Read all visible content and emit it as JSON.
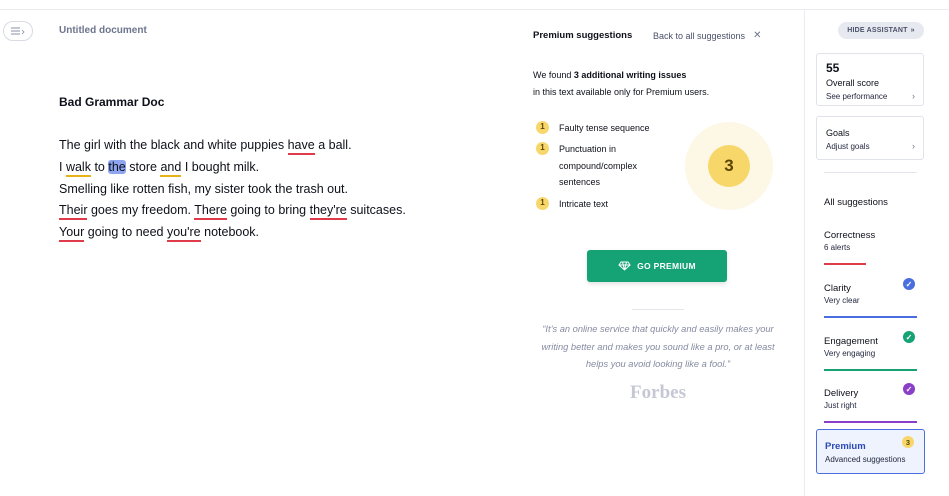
{
  "editor": {
    "doc_title": "Untitled document",
    "heading": "Bad Grammar Doc",
    "lines": [
      {
        "segments": [
          {
            "text": "The girl with the black and white puppies ",
            "mark": "none"
          },
          {
            "text": "have",
            "mark": "red"
          },
          {
            "text": " a ball.",
            "mark": "none"
          }
        ]
      },
      {
        "segments": [
          {
            "text": "I ",
            "mark": "none"
          },
          {
            "text": "walk",
            "mark": "yellow"
          },
          {
            "text": " to ",
            "mark": "none"
          },
          {
            "text": "the",
            "mark": "cursor"
          },
          {
            "text": " store ",
            "mark": "none"
          },
          {
            "text": "and",
            "mark": "yellow"
          },
          {
            "text": " I bought milk.",
            "mark": "none"
          }
        ]
      },
      {
        "segments": [
          {
            "text": "Smelling like rotten fish, my sister took the trash out.",
            "mark": "none"
          }
        ]
      },
      {
        "segments": [
          {
            "text": "Their",
            "mark": "red"
          },
          {
            "text": " goes my freedom. ",
            "mark": "none"
          },
          {
            "text": "There",
            "mark": "red"
          },
          {
            "text": " going to bring ",
            "mark": "none"
          },
          {
            "text": "they're",
            "mark": "red"
          },
          {
            "text": " suitcases.",
            "mark": "none"
          }
        ]
      },
      {
        "segments": [
          {
            "text": "Your",
            "mark": "red"
          },
          {
            "text": " going to need ",
            "mark": "none"
          },
          {
            "text": "you're",
            "mark": "red"
          },
          {
            "text": " notebook.",
            "mark": "none"
          }
        ]
      }
    ]
  },
  "premium_panel": {
    "title": "Premium suggestions",
    "back_link": "Back to all suggestions",
    "found_prefix": "We found ",
    "found_bold": "3 additional writing issues",
    "found_suffix": "in this text available only for Premium users.",
    "issues": [
      {
        "count": "1",
        "label": "Faulty tense sequence"
      },
      {
        "count": "1",
        "label": "Punctuation in compound/complex sentences"
      },
      {
        "count": "1",
        "label": "Intricate text"
      }
    ],
    "score_circle": "3",
    "cta_label": "GO PREMIUM",
    "quote": "“It’s an online service that quickly and easily makes your writing better and makes you sound like a pro, or at least helps you avoid looking like a fool.”",
    "quote_source": "Forbes"
  },
  "sidebar": {
    "hide_assistant": "HIDE ASSISTANT",
    "overall_score": {
      "value": "55",
      "label": "Overall score",
      "link": "See performance"
    },
    "goals": {
      "label": "Goals",
      "link": "Adjust goals"
    },
    "all_suggestions": "All suggestions",
    "categories": [
      {
        "name": "Correctness",
        "sub": "6 alerts",
        "color": "#e03b4b",
        "checked": false,
        "bar_fraction": 0.45
      },
      {
        "name": "Clarity",
        "sub": "Very clear",
        "color": "#4a6ee0",
        "checked": true,
        "bar_fraction": 1.0
      },
      {
        "name": "Engagement",
        "sub": "Very engaging",
        "color": "#15a274",
        "checked": true,
        "bar_fraction": 1.0
      },
      {
        "name": "Delivery",
        "sub": "Just right",
        "color": "#8a3fc7",
        "checked": true,
        "bar_fraction": 1.0
      }
    ],
    "premium": {
      "name": "Premium",
      "sub": "Advanced suggestions",
      "badge": "3"
    }
  }
}
